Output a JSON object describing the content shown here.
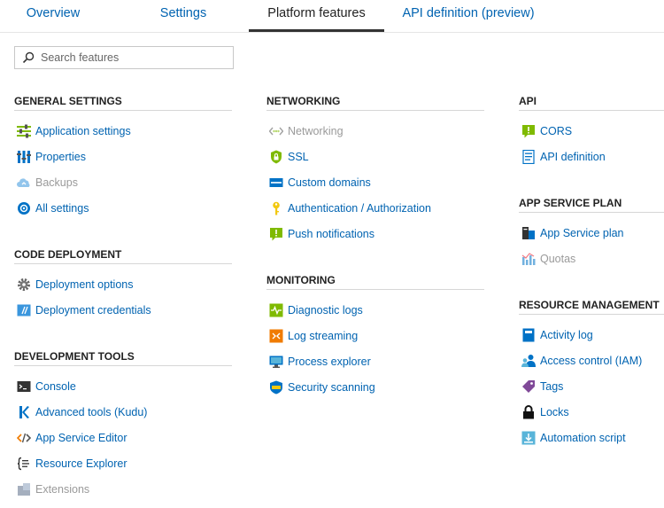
{
  "tabs": {
    "overview": "Overview",
    "settings": "Settings",
    "platform": "Platform features",
    "api": "API definition (preview)"
  },
  "search": {
    "placeholder": "Search features"
  },
  "general_settings": {
    "heading": "GENERAL SETTINGS",
    "items": [
      "Application settings",
      "Properties",
      "Backups",
      "All settings"
    ]
  },
  "code_deployment": {
    "heading": "CODE DEPLOYMENT",
    "items": [
      "Deployment options",
      "Deployment credentials"
    ]
  },
  "development_tools": {
    "heading": "DEVELOPMENT TOOLS",
    "items": [
      "Console",
      "Advanced tools (Kudu)",
      "App Service Editor",
      "Resource Explorer",
      "Extensions"
    ]
  },
  "networking": {
    "heading": "NETWORKING",
    "items": [
      "Networking",
      "SSL",
      "Custom domains",
      "Authentication / Authorization",
      "Push notifications"
    ]
  },
  "monitoring": {
    "heading": "MONITORING",
    "items": [
      "Diagnostic logs",
      "Log streaming",
      "Process explorer",
      "Security scanning"
    ]
  },
  "api": {
    "heading": "API",
    "items": [
      "CORS",
      "API definition"
    ]
  },
  "app_service_plan": {
    "heading": "APP SERVICE PLAN",
    "items": [
      "App Service plan",
      "Quotas"
    ]
  },
  "resource_management": {
    "heading": "RESOURCE MANAGEMENT",
    "items": [
      "Activity log",
      "Access control (IAM)",
      "Tags",
      "Locks",
      "Automation script"
    ]
  },
  "icons": {
    "application-settings": "sliders-icon",
    "properties": "properties-bars-icon",
    "backups": "cloud-backup-icon",
    "all-settings": "globe-settings-icon",
    "deployment-options": "gear-icon",
    "deployment-credentials": "credentials-icon",
    "console": "console-icon",
    "advanced-tools": "kudu-icon",
    "app-service-editor": "code-editor-icon",
    "resource-explorer": "braces-icon",
    "extensions": "puzzle-icon",
    "networking": "network-icon",
    "ssl": "shield-lock-icon",
    "custom-domains": "www-icon",
    "authentication": "key-icon",
    "push-notifications": "notification-icon",
    "diagnostic-logs": "heartbeat-log-icon",
    "log-streaming": "stream-icon",
    "process-explorer": "monitor-icon",
    "security-scanning": "shield-scan-icon",
    "cors": "cors-icon",
    "api-definition": "document-icon",
    "app-service-plan": "server-plan-icon",
    "quotas": "chart-icon",
    "activity-log": "log-book-icon",
    "access-control": "users-icon",
    "tags": "tag-icon",
    "locks": "lock-icon",
    "automation-script": "download-script-icon"
  },
  "colors": {
    "link": "#0063b1",
    "disabled": "#9a9a9a",
    "active_tab_underline": "#333333",
    "green_icon": "#7fba00",
    "blue_icon": "#0072c6",
    "orange_icon": "#f07b00"
  }
}
